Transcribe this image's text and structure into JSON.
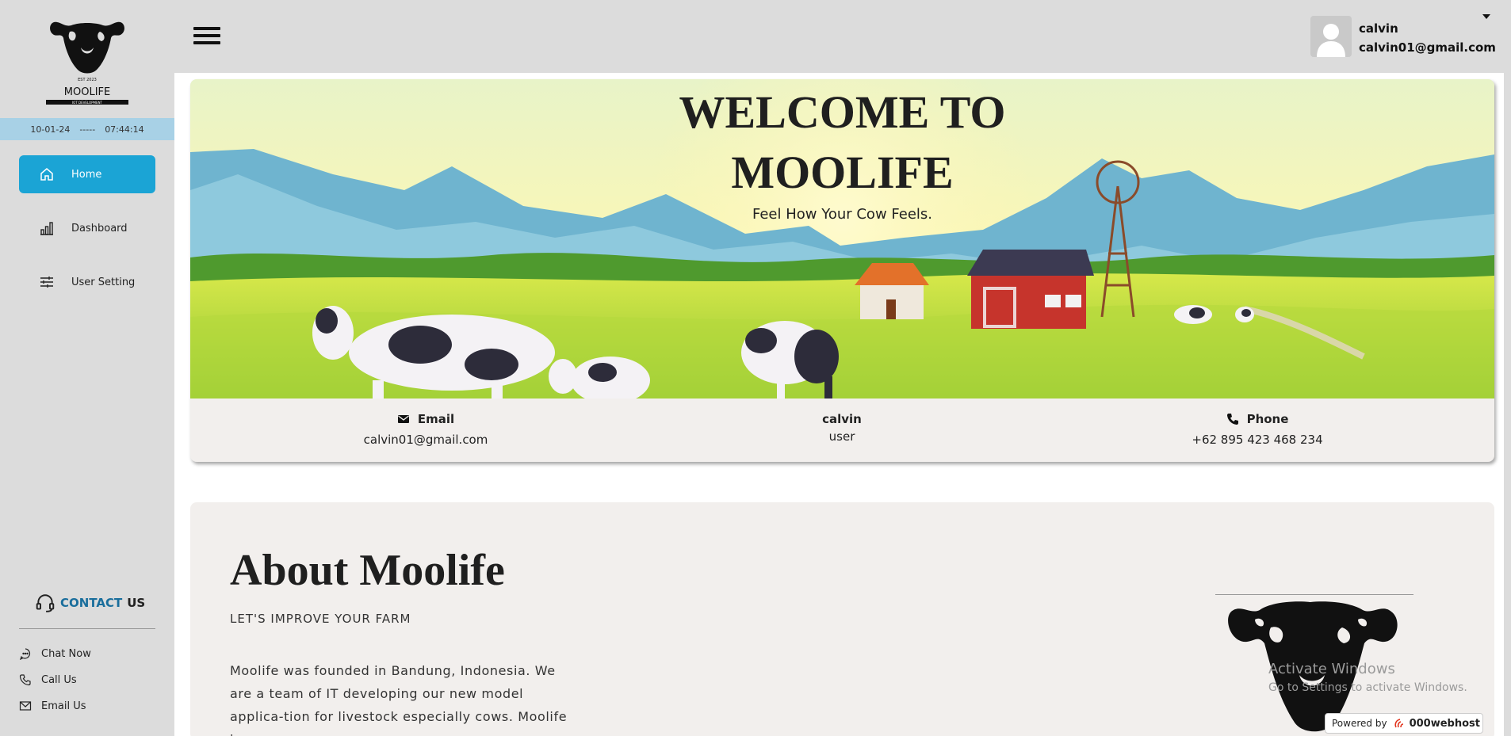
{
  "sidebar": {
    "logo_text": "MOOLIFE",
    "logo_small": "EST 2023",
    "logo_tagline": "IOT DEVELOPMENT",
    "date": "10-01-24",
    "separator": "-----",
    "time": "07:44:14",
    "nav": [
      {
        "label": "Home",
        "icon": "home-icon",
        "active": true
      },
      {
        "label": "Dashboard",
        "icon": "bar-chart-icon",
        "active": false
      },
      {
        "label": "User Setting",
        "icon": "sliders-icon",
        "active": false
      }
    ],
    "contact_word1": "CONTACT",
    "contact_word2": "US",
    "contact_items": [
      {
        "label": "Chat Now",
        "icon": "chat-icon"
      },
      {
        "label": "Call Us",
        "icon": "phone-icon"
      },
      {
        "label": "Email Us",
        "icon": "envelope-icon"
      }
    ]
  },
  "header": {
    "user_name": "calvin",
    "user_email": "calvin01@gmail.com"
  },
  "hero": {
    "title_line1": "WELCOME TO",
    "title_line2": "MOOLIFE",
    "subtitle": "Feel How Your Cow Feels."
  },
  "info": {
    "email_label": "Email",
    "email_value": "calvin01@gmail.com",
    "name_label": "calvin",
    "role": "user",
    "phone_label": "Phone",
    "phone_value": "+62 895 423 468 234"
  },
  "about": {
    "title": "About Moolife",
    "subtitle": "LET'S IMPROVE YOUR FARM",
    "body": "Moolife was founded in Bandung, Indonesia. We are a team of IT developing our new model applica-tion for livestock especially cows. Moolife is an ap-"
  },
  "overlay": {
    "activate_title": "Activate Windows",
    "activate_sub": "Go to Settings to activate Windows.",
    "powered_by": "Powered by",
    "host": "000webhost"
  },
  "colors": {
    "accent": "#1ba4d5",
    "sidebar_bg": "#dcdcdc",
    "datebar": "#a8d1e6",
    "contact": "#1a6e9c"
  }
}
